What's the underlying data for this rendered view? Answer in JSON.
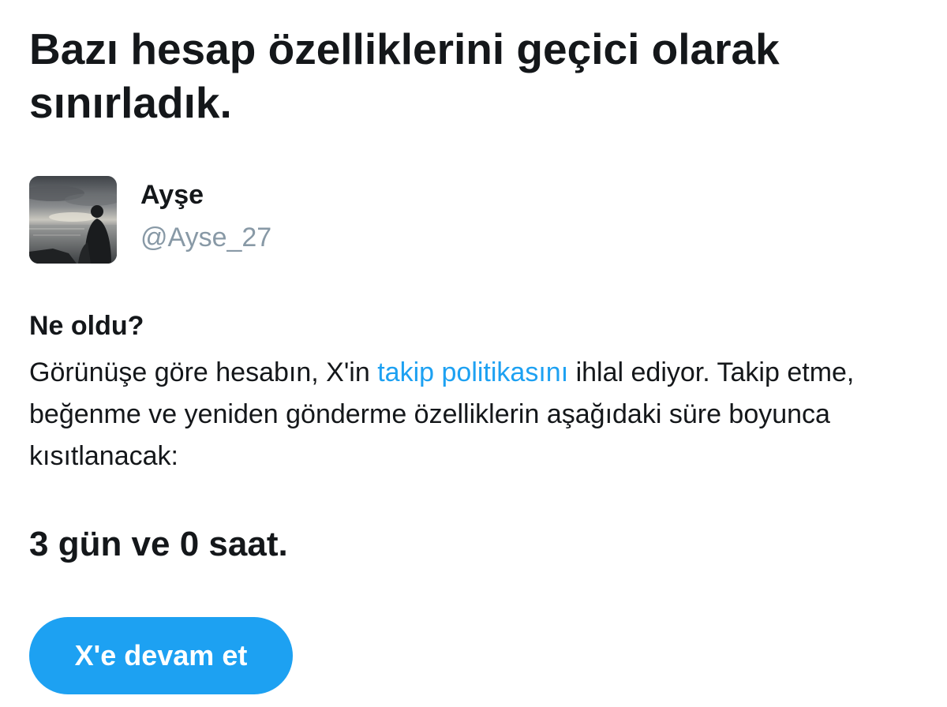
{
  "header": {
    "title": "Bazı hesap özelliklerini geçici olarak sınırladık."
  },
  "account": {
    "display_name": "Ayşe",
    "handle": "@Ayse_27",
    "avatar_icon": "profile-photo-silhouette-at-sea"
  },
  "details": {
    "heading": "Ne oldu?",
    "text_before_link": "Görünüşe göre hesabın, X'in ",
    "link_text": "takip politikasını",
    "text_after_link": " ihlal ediyor. Takip etme, beğenme ve yeniden gönderme özelliklerin aşağıdaki süre boyunca kısıtlanacak:"
  },
  "restriction": {
    "duration": "3 gün ve 0 saat."
  },
  "actions": {
    "continue_label": "X'e devam et"
  },
  "colors": {
    "accent": "#1da1f2",
    "text_primary": "#14171a",
    "text_secondary": "#8899a6"
  }
}
